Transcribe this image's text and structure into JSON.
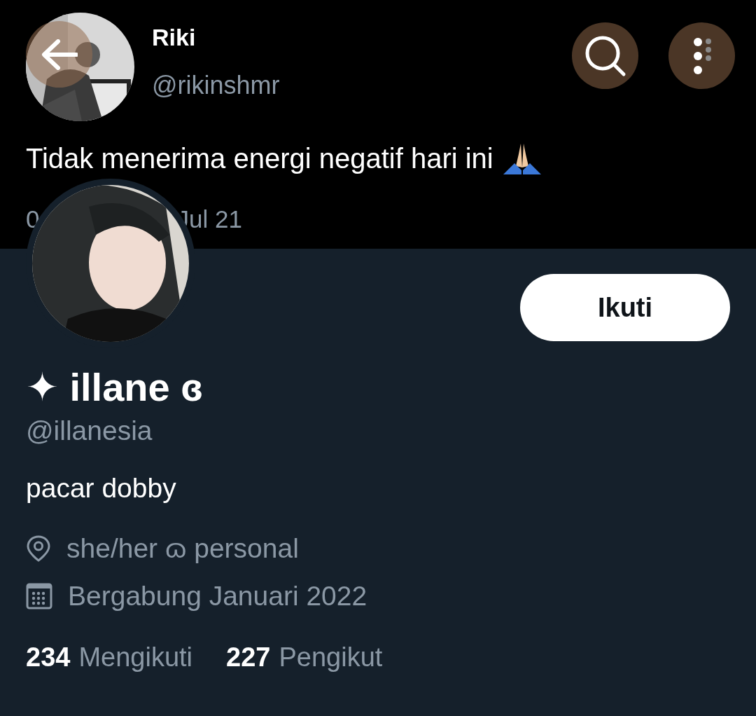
{
  "tweet": {
    "author": "Riki",
    "handle": "@rikinshmr",
    "text": "Tidak menerima energi negatif hari ini",
    "date_parts": [
      "0",
      "Jul 21"
    ]
  },
  "follow_button": {
    "label": "Ikuti"
  },
  "profile": {
    "name": "✦ illane ɞ",
    "handle": "@illanesia",
    "bio": "pacar dobby",
    "details": [
      {
        "kind": "location",
        "text": "she/her ɷ personal"
      },
      {
        "kind": "joined",
        "text": "Bergabung Januari 2022"
      }
    ],
    "stats": [
      {
        "count": "234",
        "label": "Mengikuti"
      },
      {
        "count": "227",
        "label": "Pengikut"
      }
    ]
  }
}
